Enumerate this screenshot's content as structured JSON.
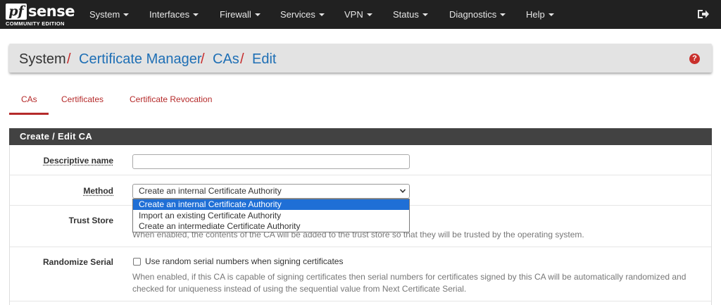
{
  "brand": {
    "logo_mark": "pf",
    "logo_word": "sense",
    "edition": "COMMUNITY EDITION"
  },
  "nav": {
    "items": [
      "System",
      "Interfaces",
      "Firewall",
      "Services",
      "VPN",
      "Status",
      "Diagnostics",
      "Help"
    ],
    "logout_icon": "sign-out-icon"
  },
  "breadcrumb": {
    "root": "System",
    "sep": "/",
    "links": [
      "Certificate Manager",
      "CAs",
      "Edit"
    ]
  },
  "help_icon": "question-circle-icon",
  "tabs": {
    "items": [
      "CAs",
      "Certificates",
      "Certificate Revocation"
    ],
    "active": "CAs"
  },
  "panel": {
    "title": "Create / Edit CA",
    "descriptive_name": {
      "label": "Descriptive name",
      "value": ""
    },
    "method": {
      "label": "Method",
      "selected": "Create an internal Certificate Authority",
      "options": [
        "Create an internal Certificate Authority",
        "Import an existing Certificate Authority",
        "Create an intermediate Certificate Authority"
      ]
    },
    "trust_store": {
      "label": "Trust Store",
      "help": "When enabled, the contents of the CA will be added to the trust store so that they will be trusted by the operating system."
    },
    "randomize_serial": {
      "label": "Randomize Serial",
      "checkbox_label": "Use random serial numbers when signing certificates",
      "checked": false,
      "help_line1": "When enabled, if this CA is capable of signing certificates then serial numbers for certificates signed by this CA will be automatically randomized and",
      "help_line2": "checked for uniqueness instead of using the sequential value from Next Certificate Serial."
    }
  },
  "colors": {
    "nav_bg": "#212121",
    "accent_red": "#b52a2a",
    "link_blue": "#1e6fb5",
    "panel_head": "#424242",
    "select_highlight": "#1f6fd6"
  }
}
